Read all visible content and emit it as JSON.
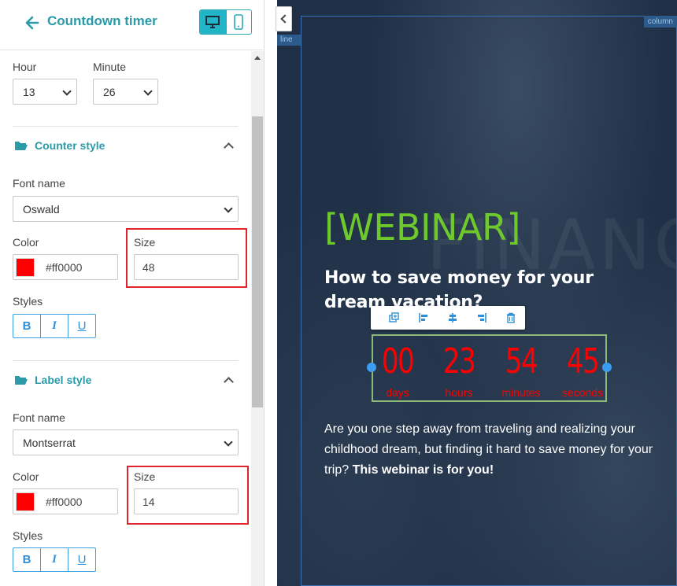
{
  "panel": {
    "title": "Countdown timer",
    "time": {
      "hour_label": "Hour",
      "hour_value": "13",
      "minute_label": "Minute",
      "minute_value": "26"
    },
    "counter_style": {
      "title": "Counter style",
      "font_label": "Font name",
      "font_value": "Oswald",
      "color_label": "Color",
      "color_value": "#ff0000",
      "size_label": "Size",
      "size_value": "48",
      "styles_label": "Styles"
    },
    "label_style": {
      "title": "Label style",
      "font_label": "Font name",
      "font_value": "Montserrat",
      "color_label": "Color",
      "color_value": "#ff0000",
      "size_label": "Size",
      "size_value": "14",
      "styles_label": "Styles"
    },
    "style_buttons": {
      "bold": "B",
      "italic": "I",
      "underline": "U"
    }
  },
  "canvas": {
    "line_tag": "line",
    "column_tag": "column",
    "headline": "[WEBINAR]",
    "subheadline": "How to save money for your dream vacation?",
    "body_text": "Are you one step away from traveling and realizing your childhood dream, but finding it hard to save money for your trip? ",
    "body_bold": "This webinar is for you!",
    "countdown": {
      "days": "00",
      "days_label": "days",
      "hours": "23",
      "hours_label": "hours",
      "minutes": "54",
      "minutes_label": "minutes",
      "seconds": "45",
      "seconds_label": "seconds"
    }
  },
  "colors": {
    "accent": "#2a9aa8",
    "counter": "#ff0000",
    "headline": "#6dc92c",
    "highlight": "#e0242c"
  }
}
